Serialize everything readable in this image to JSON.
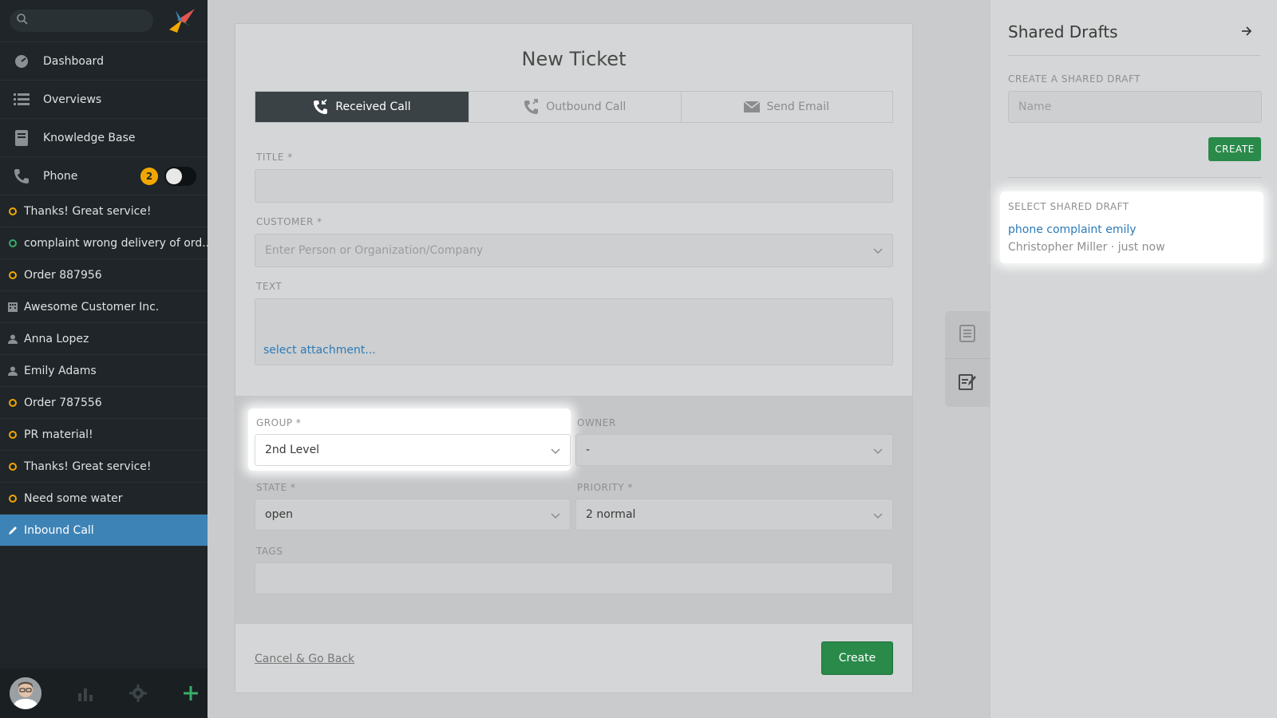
{
  "sidebar": {
    "search_placeholder": "",
    "menu": [
      {
        "label": "Dashboard",
        "icon": "dashboard-icon"
      },
      {
        "label": "Overviews",
        "icon": "list-icon"
      },
      {
        "label": "Knowledge Base",
        "icon": "book-icon"
      },
      {
        "label": "Phone",
        "icon": "phone-icon",
        "badge": "2"
      }
    ],
    "tasks": [
      {
        "label": "Thanks! Great service!",
        "icon": "ticket-ring-icon",
        "color": "#f2a700"
      },
      {
        "label": "complaint wrong delivery of ord...",
        "icon": "ticket-ring-icon",
        "color": "#38ad69"
      },
      {
        "label": "Order 887956",
        "icon": "ticket-ring-icon",
        "color": "#f2a700"
      },
      {
        "label": "Awesome Customer Inc.",
        "icon": "organization-icon"
      },
      {
        "label": "Anna Lopez",
        "icon": "user-icon"
      },
      {
        "label": "Emily Adams",
        "icon": "user-icon"
      },
      {
        "label": "Order 787556",
        "icon": "ticket-ring-icon",
        "color": "#f2a700"
      },
      {
        "label": "PR material!",
        "icon": "ticket-ring-icon",
        "color": "#f2a700"
      },
      {
        "label": "Thanks! Great service!",
        "icon": "ticket-ring-icon",
        "color": "#f2a700"
      },
      {
        "label": "Need some water",
        "icon": "ticket-ring-icon",
        "color": "#f2a700"
      },
      {
        "label": "Inbound Call",
        "icon": "pencil-icon",
        "active": true
      }
    ]
  },
  "ticket": {
    "title": "New Ticket",
    "tabs": [
      {
        "label": "Received Call",
        "icon": "received-call-icon",
        "active": true
      },
      {
        "label": "Outbound Call",
        "icon": "outbound-call-icon"
      },
      {
        "label": "Send Email",
        "icon": "email-icon"
      }
    ],
    "title_label": "TITLE *",
    "customer_label": "CUSTOMER *",
    "customer_placeholder": "Enter Person or Organization/Company",
    "text_label": "TEXT",
    "attachment_link": "select attachment...",
    "group_label": "GROUP *",
    "group_value": "2nd Level",
    "owner_label": "OWNER",
    "owner_value": "-",
    "state_label": "STATE *",
    "state_value": "open",
    "priority_label": "PRIORITY *",
    "priority_value": "2 normal",
    "tags_label": "TAGS",
    "cancel_label": "Cancel & Go Back",
    "create_label": "Create"
  },
  "shared_drafts": {
    "title": "Shared Drafts",
    "create_label": "CREATE A SHARED DRAFT",
    "name_placeholder": "Name",
    "create_button": "CREATE",
    "select_label": "SELECT SHARED DRAFT",
    "draft_name": "phone complaint emily",
    "draft_meta": "Christopher Miller · just now"
  },
  "colors": {
    "accent_green": "#298a4a",
    "active_blue": "#3d83b6",
    "badge_orange": "#f2a700",
    "link_blue": "#2c7ab8"
  }
}
